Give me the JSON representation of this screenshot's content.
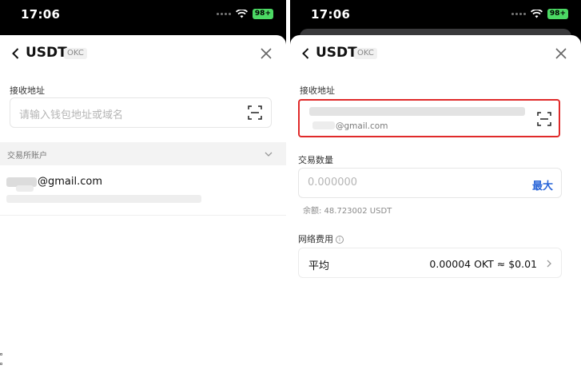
{
  "screens": [
    {
      "status": {
        "time": "17:06",
        "battery": "98+"
      },
      "header": {
        "title": "USDT",
        "badge": "OKC"
      },
      "receive_label": "接收地址",
      "address_placeholder": "请输入钱包地址或域名",
      "exchange_section": "交易所账户",
      "account": {
        "email": "@gmail.com"
      }
    },
    {
      "status": {
        "time": "17:06",
        "battery": "98+"
      },
      "header": {
        "title": "USDT",
        "badge": "OKC"
      },
      "receive_label": "接收地址",
      "address_email": "@gmail.com",
      "amount_label": "交易数量",
      "amount_placeholder": "0.000000",
      "max_label": "最大",
      "balance": "余额: 48.723002 USDT",
      "fee_label": "网络费用",
      "fee": {
        "name": "平均",
        "value": "0.00004 OKT ≈ $0.01"
      }
    }
  ],
  "icons": [
    "back-icon",
    "close-icon",
    "scan-icon",
    "chevron-down-icon",
    "chevron-right-icon",
    "info-icon",
    "wifi-icon",
    "battery-icon"
  ],
  "colors": {
    "highlight": "#e02a2a",
    "link": "#2a66d8",
    "battery": "#4cd964"
  }
}
